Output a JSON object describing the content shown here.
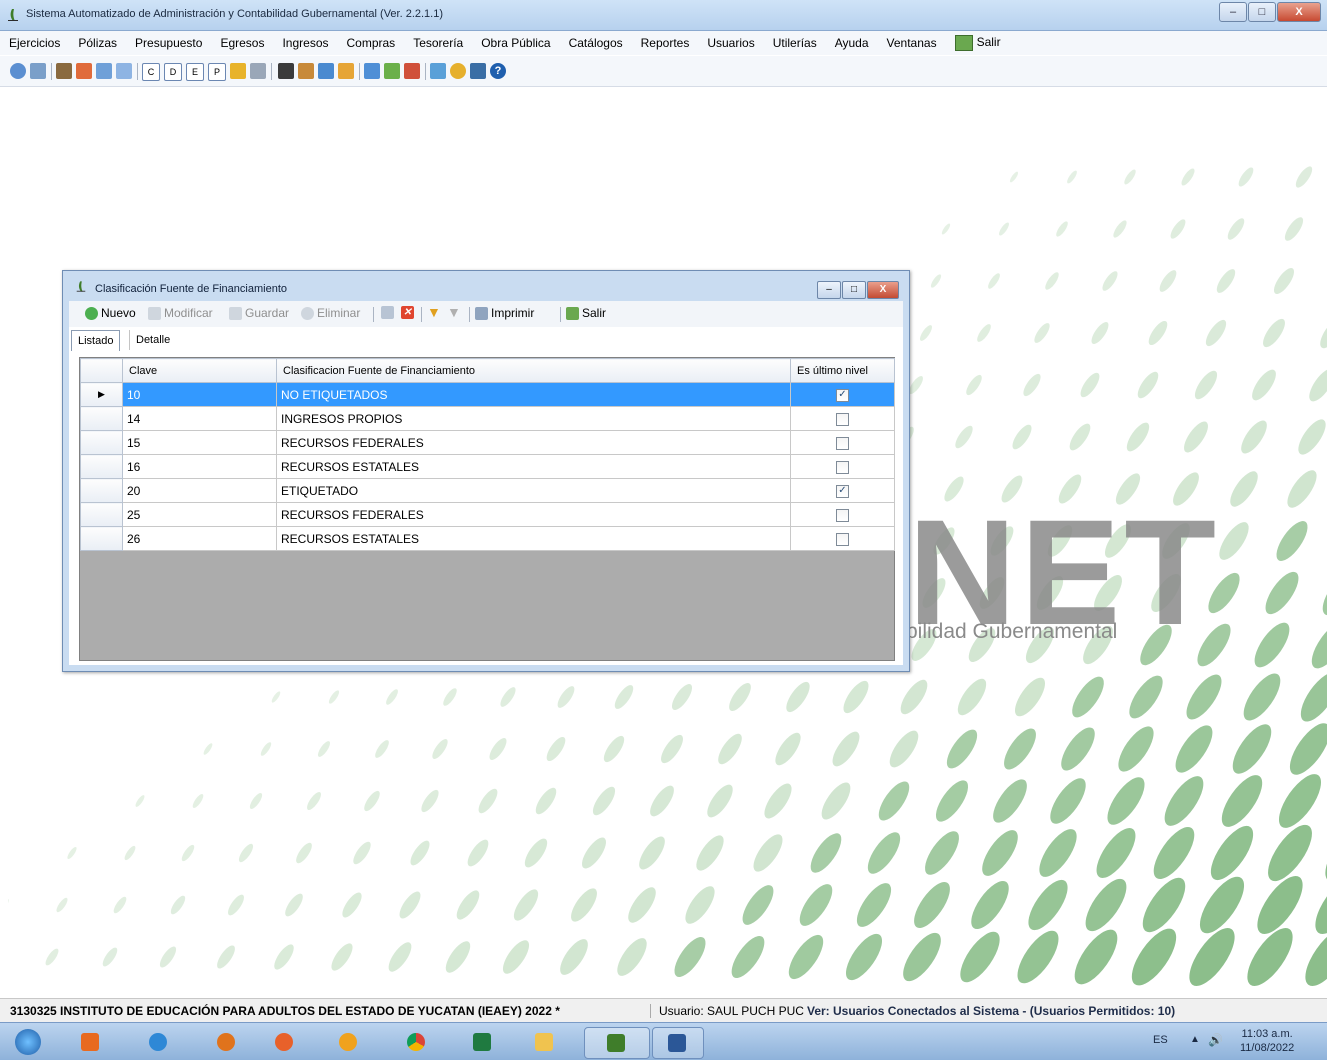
{
  "window": {
    "title": "Sistema Automatizado de Administración y Contabilidad Gubernamental  (Ver. 2.2.1.1)",
    "minimize": "–",
    "maximize": "□",
    "close": "X"
  },
  "menu": {
    "items": [
      "Ejercicios",
      "Pólizas",
      "Presupuesto",
      "Egresos",
      "Ingresos",
      "Compras",
      "Tesorería",
      "Obra Pública",
      "Catálogos",
      "Reportes",
      "Usuarios",
      "Utilerías",
      "Ayuda",
      "Ventanas"
    ],
    "salir": "Salir"
  },
  "toolbar": {
    "icons": [
      "refresh-icon",
      "document-icon",
      "truck-icon",
      "arrows-icon",
      "list-icon",
      "table-icon",
      "c-icon",
      "d-icon",
      "e-icon",
      "p-icon",
      "pb-icon",
      "print-icon",
      "clipboard-icon",
      "pencil-icon",
      "folder-icon",
      "box-icon",
      "report-icon",
      "tools-icon",
      "user-icon",
      "tree-icon",
      "gear-icon",
      "book-icon",
      "help-icon"
    ]
  },
  "background": {
    "brand_net": "NET",
    "brand_sub": "bilidad Gubernamental"
  },
  "child_window": {
    "title": "Clasificación Fuente de Financiamiento",
    "toolbar": {
      "nuevo": "Nuevo",
      "modificar": "Modificar",
      "guardar": "Guardar",
      "eliminar": "Eliminar",
      "imprimir": "Imprimir",
      "salir": "Salir"
    },
    "tabs": {
      "listado": "Listado",
      "detalle": "Detalle"
    },
    "grid": {
      "columns": [
        "Clave",
        "Clasificacion Fuente de Financiamiento",
        "Es último nivel"
      ],
      "rows": [
        {
          "clave": "10",
          "nombre": "NO ETIQUETADOS",
          "ultimo": true
        },
        {
          "clave": "14",
          "nombre": "INGRESOS PROPIOS",
          "ultimo": false
        },
        {
          "clave": "15",
          "nombre": "RECURSOS FEDERALES",
          "ultimo": false
        },
        {
          "clave": "16",
          "nombre": "RECURSOS ESTATALES",
          "ultimo": false
        },
        {
          "clave": "20",
          "nombre": "ETIQUETADO",
          "ultimo": true
        },
        {
          "clave": "25",
          "nombre": "RECURSOS FEDERALES",
          "ultimo": false
        },
        {
          "clave": "26",
          "nombre": "RECURSOS ESTATALES",
          "ultimo": false
        }
      ],
      "selected_row_marker": "▶"
    }
  },
  "statusbar": {
    "entity": "3130325 INSTITUTO DE EDUCACIÓN PARA ADULTOS DEL ESTADO DE YUCATAN (IEAEY)  2022  *",
    "usuario": "Usuario: SAUL PUCH PUC",
    "conectados": "Ver: Usuarios Conectados al Sistema - (Usuarios Permitidos: 10)"
  },
  "taskbar": {
    "lang": "ES",
    "tray_up": "▲",
    "volume": "🔊",
    "time": "11:03 a.m.",
    "date": "11/08/2022"
  },
  "colors": {
    "selection": "#3399ff",
    "brand_green": "#6aa84f"
  }
}
